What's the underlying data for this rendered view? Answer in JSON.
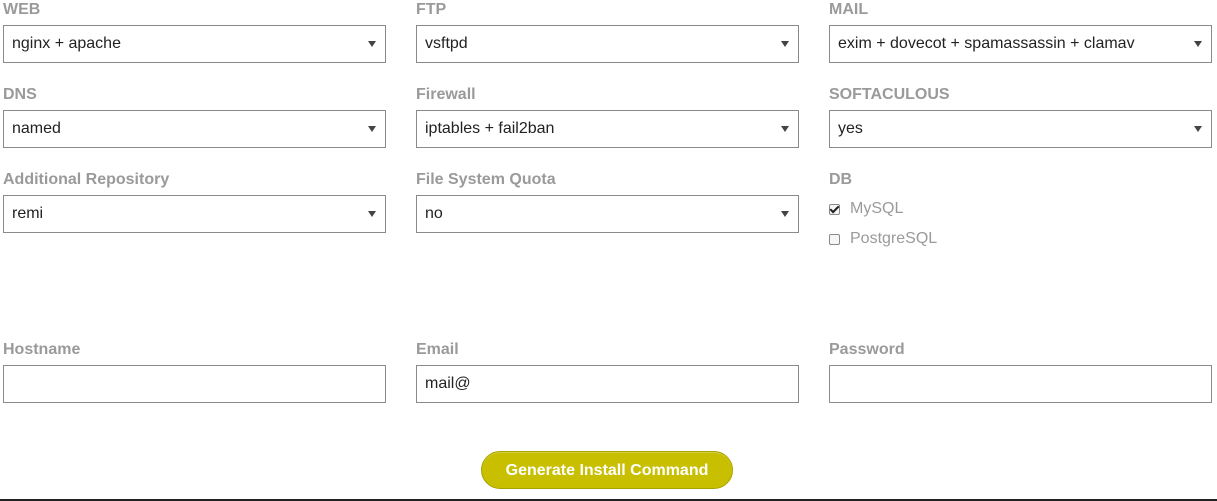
{
  "form": {
    "web": {
      "label": "WEB",
      "value": "nginx + apache"
    },
    "ftp": {
      "label": "FTP",
      "value": "vsftpd"
    },
    "mail": {
      "label": "MAIL",
      "value": "exim + dovecot + spamassassin + clamav"
    },
    "dns": {
      "label": "DNS",
      "value": "named"
    },
    "firewall": {
      "label": "Firewall",
      "value": "iptables + fail2ban"
    },
    "softaculous": {
      "label": "SOFTACULOUS",
      "value": "yes"
    },
    "additional_repository": {
      "label": "Additional Repository",
      "value": "remi"
    },
    "file_system_quota": {
      "label": "File System Quota",
      "value": "no"
    },
    "db": {
      "label": "DB",
      "options": [
        {
          "label": "MySQL",
          "checked": true
        },
        {
          "label": "PostgreSQL",
          "checked": false
        }
      ]
    },
    "hostname": {
      "label": "Hostname",
      "value": ""
    },
    "email": {
      "label": "Email",
      "value": "mail@"
    },
    "password": {
      "label": "Password",
      "value": ""
    }
  },
  "actions": {
    "generate_label": "Generate Install Command"
  },
  "icons": {
    "select_caret": "chevron-down-icon",
    "checkbox_checked": "checkmark-icon"
  },
  "colors": {
    "label_gray": "#9a9a9a",
    "button_yellow": "#c8bf00",
    "button_text": "#ffffff",
    "border": "#8a8a8a"
  }
}
